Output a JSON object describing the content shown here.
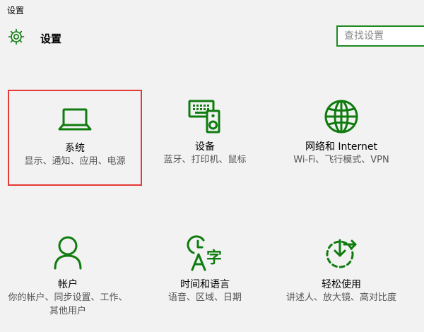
{
  "window": {
    "title": "设置"
  },
  "header": {
    "title": "设置",
    "gear_icon": "gear-icon"
  },
  "search": {
    "placeholder": "查找设置"
  },
  "accent_color": "#107c10",
  "selection_color": "#e53935",
  "tiles": [
    {
      "id": "system",
      "title": "系统",
      "desc": "显示、通知、应用、电源",
      "icon": "laptop-icon",
      "selected": true
    },
    {
      "id": "devices",
      "title": "设备",
      "desc": "蓝牙、打印机、鼠标",
      "icon": "keyboard-speaker-icon"
    },
    {
      "id": "network",
      "title": "网络和 Internet",
      "desc": "Wi-Fi、飞行模式、VPN",
      "icon": "globe-icon"
    },
    {
      "id": "accounts",
      "title": "帐户",
      "desc": "你的帐户、同步设置、工作、其他用户",
      "icon": "person-icon"
    },
    {
      "id": "time-language",
      "title": "时间和语言",
      "desc": "语音、区域、日期",
      "icon": "time-language-icon"
    },
    {
      "id": "ease-of-access",
      "title": "轻松使用",
      "desc": "讲述人、放大镜、高对比度",
      "icon": "ease-of-access-icon"
    }
  ]
}
